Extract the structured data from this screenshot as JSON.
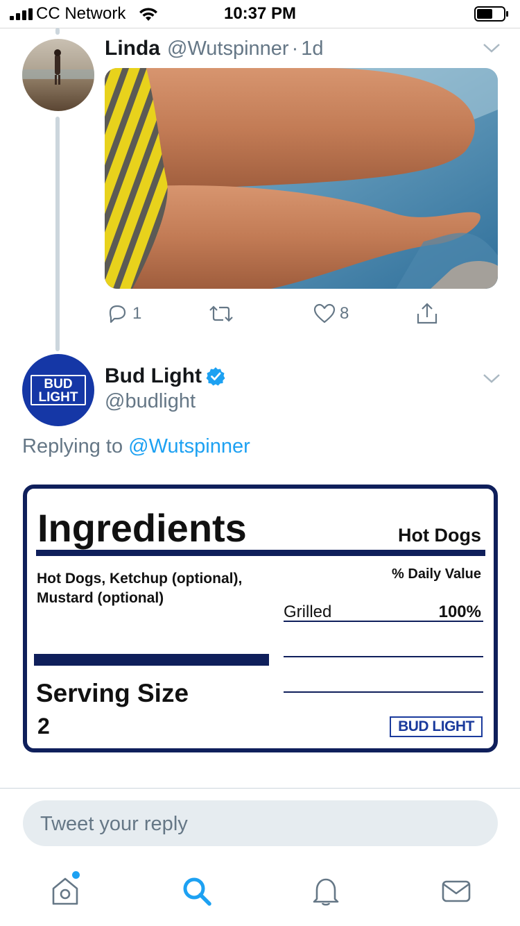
{
  "status_bar": {
    "carrier": "CC Network",
    "time": "10:37 PM",
    "icons": [
      "signal-icon",
      "wifi-icon",
      "battery-icon"
    ]
  },
  "tweet_parent": {
    "name": "Linda",
    "handle": "@Wutspinner",
    "separator": "·",
    "age": "1d",
    "photo_desc_icon": "photo",
    "actions": {
      "reply_count": "1",
      "retweet_count": "",
      "like_count": "8"
    }
  },
  "tweet_reply": {
    "name": "Bud Light",
    "verified": true,
    "handle": "@budlight",
    "replying_prefix": "Replying to",
    "replying_handle": "@Wutspinner",
    "avatar_text_line1": "BUD",
    "avatar_text_line2": "LIGHT",
    "card": {
      "title": "Ingredients",
      "product": "Hot Dogs",
      "ingredients": "Hot Dogs, Ketchup (optional), Mustard (optional)",
      "daily_value_label": "% Daily Value",
      "row_label": "Grilled",
      "row_value": "100%",
      "serving_label": "Serving Size",
      "serving_value": "2",
      "brand": "BUD LIGHT"
    }
  },
  "reply_input": {
    "placeholder": "Tweet your reply"
  },
  "tab_bar": {
    "items": [
      "home-icon",
      "search-icon",
      "notifications-icon",
      "messages-icon"
    ],
    "active": "search-icon"
  },
  "colors": {
    "accent": "#1da1f2",
    "secondary_text": "#657786",
    "card_navy": "#0f1f5b",
    "bud_blue": "#1537a6"
  }
}
